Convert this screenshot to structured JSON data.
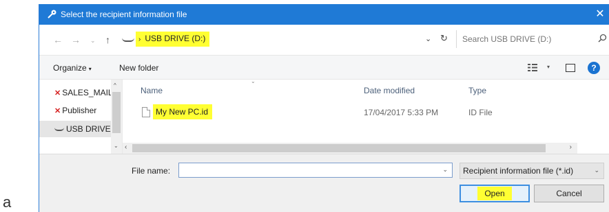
{
  "window": {
    "title": "Select the recipient information file",
    "close_glyph": "✕"
  },
  "page_letter": "a",
  "addressbar": {
    "back_glyph": "←",
    "forward_glyph": "→",
    "recent_glyph": "⌄",
    "up_glyph": "↑",
    "crumb_sep": "›",
    "location": "USB DRIVE (D:)",
    "dropdown_glyph": "⌄",
    "refresh_glyph": "↻"
  },
  "search": {
    "placeholder": "Search USB DRIVE (D:)",
    "icon": "search-icon"
  },
  "toolbar": {
    "organize_label": "Organize",
    "organize_caret": "▾",
    "new_folder_label": "New folder",
    "view_caret": "▾",
    "help_label": "?"
  },
  "nav": {
    "items": [
      {
        "label": "SALES_MAIL",
        "icon": "red-x-drive-icon"
      },
      {
        "label": "Publisher",
        "icon": "red-x-drive-icon"
      },
      {
        "label": "USB DRIVE",
        "icon": "drive-icon"
      }
    ],
    "scroll_up": "^",
    "scroll_down": "⌄"
  },
  "file_list": {
    "columns": [
      "Name",
      "Date modified",
      "Type"
    ],
    "sort_glyph": "⌄",
    "rows": [
      {
        "name": "My New PC.id",
        "date_modified": "17/04/2017 5:33 PM",
        "type": "ID File"
      }
    ],
    "scroll_left": "‹",
    "scroll_right": "›"
  },
  "footer": {
    "file_name_label": "File name:",
    "file_name_value": "",
    "file_name_caret": "⌄",
    "file_type_value": "Recipient information file (*.id)",
    "file_type_caret": "⌄",
    "open_label": "Open",
    "cancel_label": "Cancel"
  },
  "colors": {
    "titlebar": "#1f7ad6",
    "highlight": "#ffff33",
    "help_icon": "#1a73d1"
  }
}
